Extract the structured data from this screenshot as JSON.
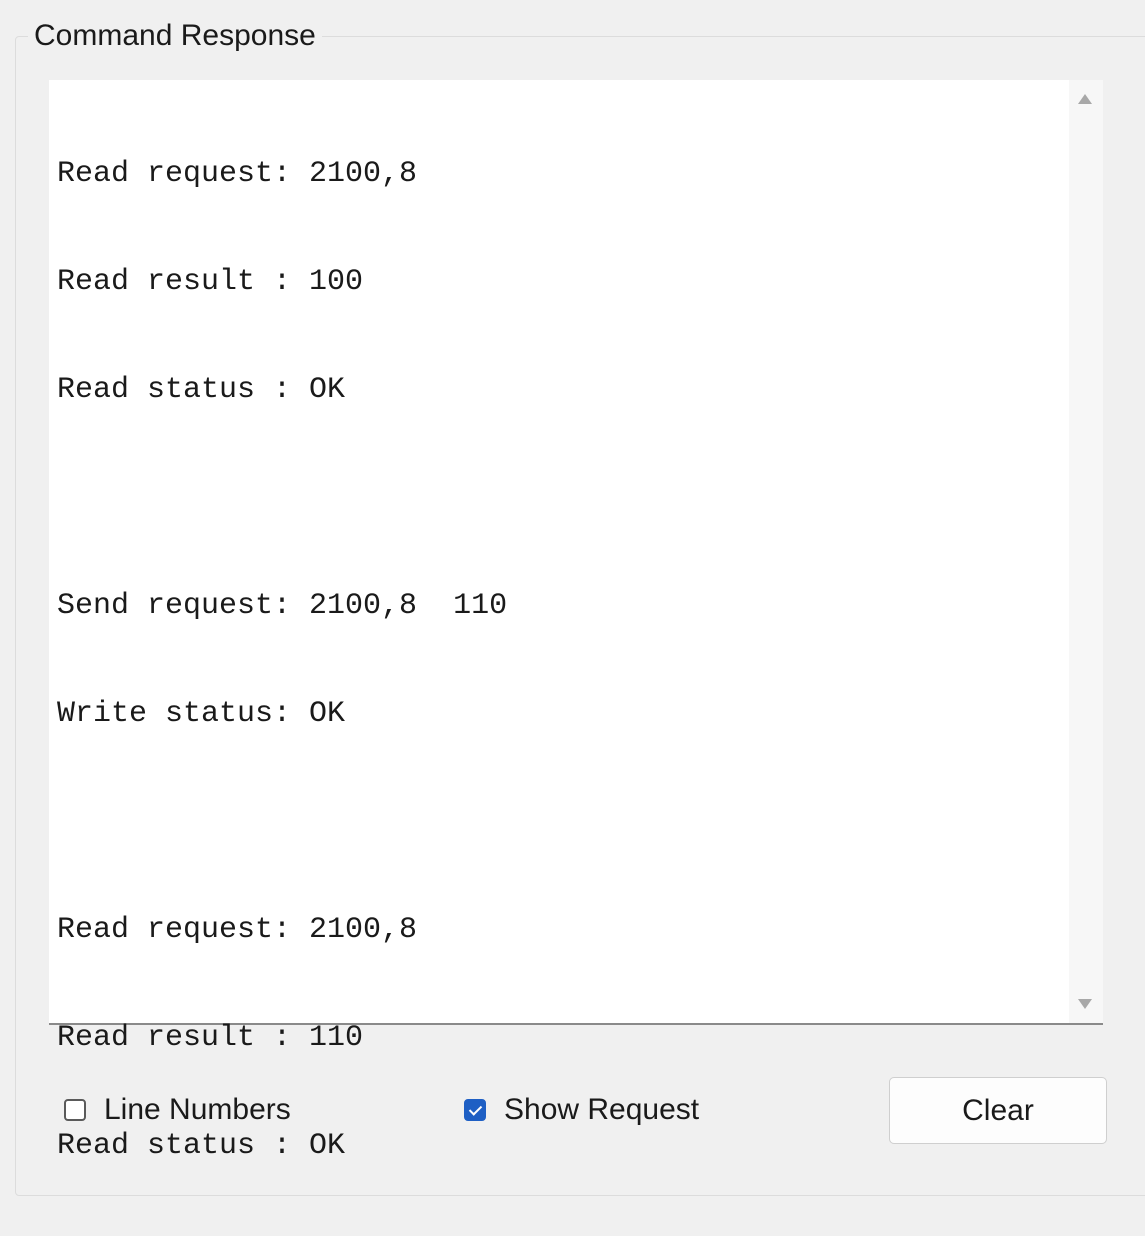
{
  "group": {
    "title": "Command Response"
  },
  "response": {
    "lines": [
      "Read request: 2100,8",
      "Read result : 100",
      "Read status : OK",
      "",
      "Send request: 2100,8  110",
      "Write status: OK",
      "",
      "Read request: 2100,8",
      "Read result : 110",
      "Read status : OK"
    ]
  },
  "options": {
    "line_numbers_label": "Line Numbers",
    "line_numbers_checked": false,
    "show_request_label": "Show Request",
    "show_request_checked": true
  },
  "buttons": {
    "clear_label": "Clear"
  },
  "colors": {
    "checkbox_accent": "#1e5fc4",
    "background": "#f0f0f0"
  }
}
